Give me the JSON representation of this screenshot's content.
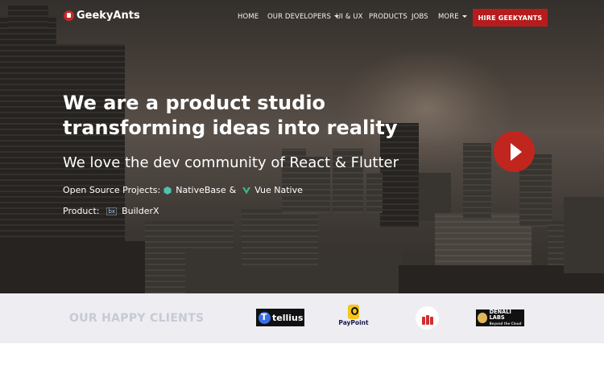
{
  "brand": {
    "name": "GeekyAnts"
  },
  "nav": {
    "items": [
      {
        "label": "HOME",
        "has_dropdown": false
      },
      {
        "label": "OUR DEVELOPERS",
        "has_dropdown": true
      },
      {
        "label": "UI & UX",
        "has_dropdown": false
      },
      {
        "label": "PRODUCTS",
        "has_dropdown": false
      },
      {
        "label": "JOBS",
        "has_dropdown": false
      },
      {
        "label": "MORE",
        "has_dropdown": true
      }
    ],
    "cta": "HIRE GEEKYANTS"
  },
  "hero": {
    "headline_line1": "We are a product studio",
    "headline_line2": "transforming ideas into reality",
    "subheadline": "We love the dev community of React & Flutter",
    "open_source": {
      "label": "Open Source Projects:",
      "project1": "NativeBase",
      "separator": "&",
      "project2": "Vue Native"
    },
    "product": {
      "label": "Product:",
      "icon_text": "bx",
      "name": "BuilderX"
    },
    "play_icon": "play-icon"
  },
  "clients": {
    "title": "OUR HAPPY CLIENTS",
    "logos": [
      {
        "name": "tellius",
        "text": "tellius"
      },
      {
        "name": "paypoint",
        "text": "PayPoint"
      },
      {
        "name": "red-bars-logo",
        "text": ""
      },
      {
        "name": "denali-labs",
        "text": "DENALI LABS",
        "tagline": "Beyond the Cloud"
      }
    ]
  },
  "colors": {
    "accent": "#b71c1c",
    "play_button": "#c0261e",
    "clients_bg": "#ededf2",
    "clients_title": "#c6cad4"
  }
}
